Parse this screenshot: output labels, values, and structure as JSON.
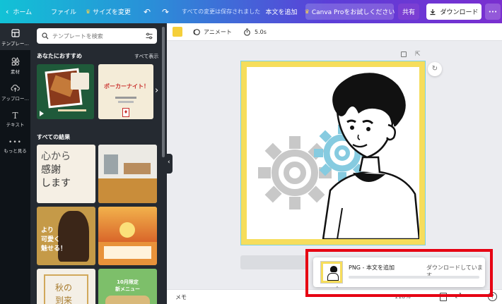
{
  "topbar": {
    "home": "ホーム",
    "file": "ファイル",
    "resize": "サイズを変更",
    "saved_status": "すべての変更は保存されました",
    "add_body_text": "本文を追加",
    "canva_pro": "Canva Proをお試しください",
    "share": "共有",
    "download": "ダウンロード",
    "more": "•••"
  },
  "rail": {
    "templates": "テンプレー…",
    "elements": "素材",
    "uploads": "アップロー…",
    "text": "テキスト",
    "more": "もっと見る"
  },
  "panel": {
    "search_placeholder": "テンプレートを検索",
    "recommended_title": "あなたにおすすめ",
    "show_all": "すべて表示",
    "all_results_title": "すべての結果",
    "tile_texts": {
      "tile2_title": "ポーカーナイト！",
      "tile3_line1": "心から",
      "tile3_line2": "感謝",
      "tile3_line3": "します",
      "tile5_line1": "より",
      "tile5_line2": "可愛く",
      "tile5_line3": "魅せる！",
      "tile7_line1": "秋の",
      "tile7_line2": "到来",
      "tile8_line1": "10月限定",
      "tile8_line2": "新メニュー"
    }
  },
  "toolbar": {
    "animate": "アニメート",
    "duration": "5.0s"
  },
  "bottombar": {
    "notes": "メモ",
    "zoom": "118%"
  },
  "popup": {
    "title": "PNG - 本文を追加",
    "status": "ダウンロードしています"
  },
  "colors": {
    "canvas_yellow": "#f6dd5b",
    "highlight_red": "#e60012",
    "share_button": "#7a3fd3",
    "toolbar_color_swatch": "#f5cf3a"
  }
}
